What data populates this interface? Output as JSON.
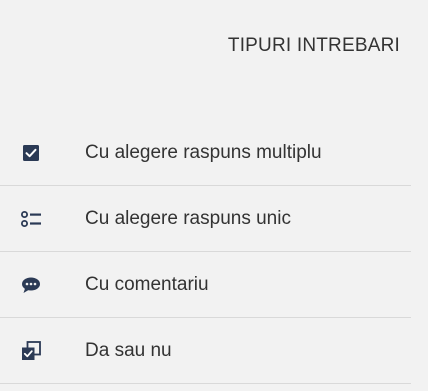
{
  "panel": {
    "title": "TIPURI INTREBARI"
  },
  "question_types": [
    {
      "label": "Cu alegere raspuns multiplu",
      "icon": "checkbox-checked-icon"
    },
    {
      "label": "Cu alegere raspuns unic",
      "icon": "radio-list-icon"
    },
    {
      "label": "Cu comentariu",
      "icon": "comment-bubble-icon"
    },
    {
      "label": "Da sau nu",
      "icon": "yes-no-icon"
    }
  ],
  "colors": {
    "background": "#f2f2f2",
    "text": "#333333",
    "icon": "#2b3a55",
    "divider": "#d9d9d9"
  }
}
